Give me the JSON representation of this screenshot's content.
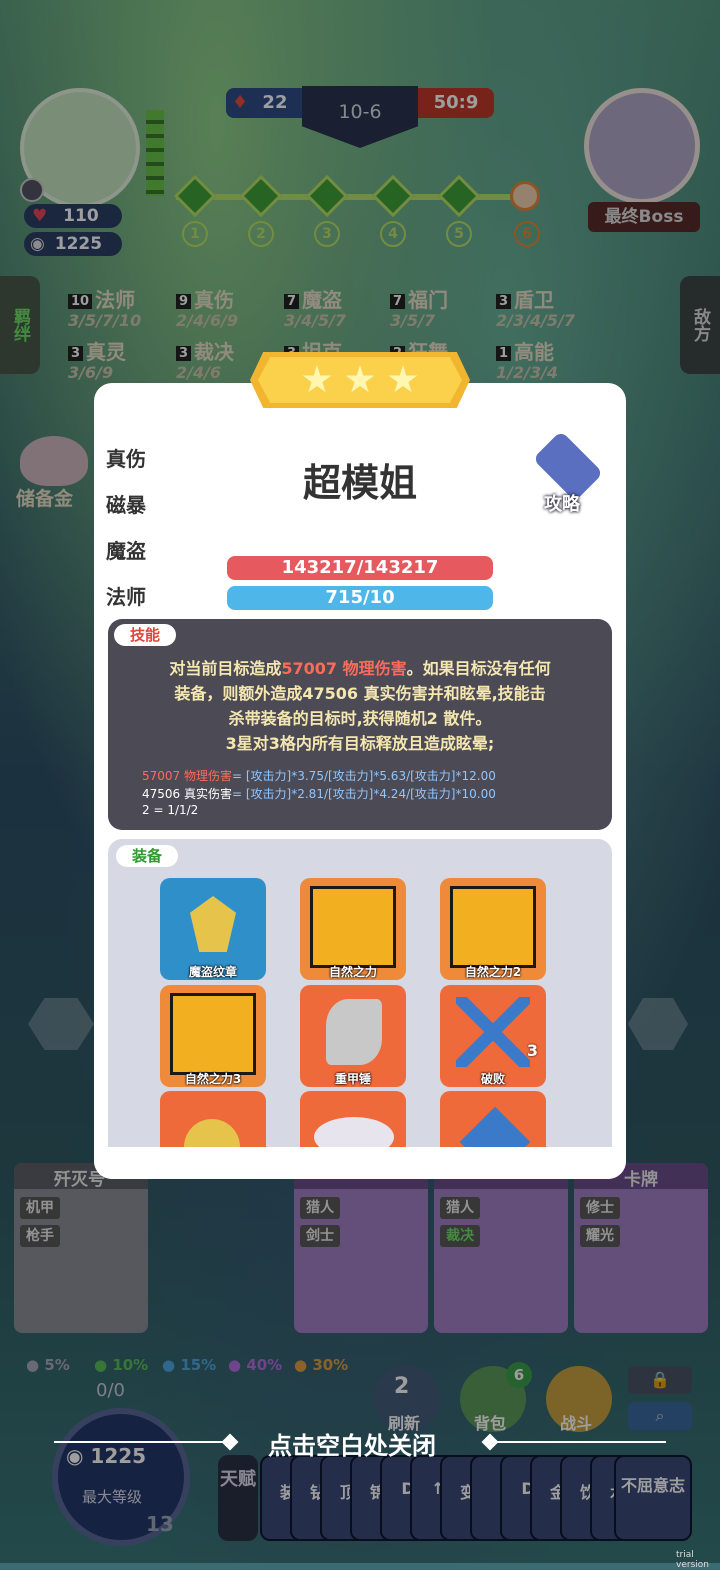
{
  "round": {
    "left_count": "22",
    "stage": "10-6",
    "score": "50:9"
  },
  "player": {
    "hp": "110",
    "gold": "1225"
  },
  "boss": {
    "label": "最终Boss"
  },
  "stage_nodes": [
    "1",
    "2",
    "3",
    "4",
    "5",
    "6"
  ],
  "side_tabs": {
    "left": "羁绊",
    "right": "敌方"
  },
  "traits": [
    {
      "count": "10",
      "name": "法师",
      "tiers": "3/5/7/10"
    },
    {
      "count": "9",
      "name": "真伤",
      "tiers": "2/4/6/9"
    },
    {
      "count": "7",
      "name": "魔盗",
      "tiers": "3/4/5/7"
    },
    {
      "count": "7",
      "name": "福门",
      "tiers": "3/5/7"
    },
    {
      "count": "3",
      "name": "盾卫",
      "tiers": "2/3/4/5/7"
    },
    {
      "count": "3",
      "name": "真灵",
      "tiers": "3/6/9"
    },
    {
      "count": "3",
      "name": "裁决",
      "tiers": "2/4/6"
    },
    {
      "count": "3",
      "name": "坦克",
      "tiers": ""
    },
    {
      "count": "2",
      "name": "狂舞",
      "tiers": ""
    },
    {
      "count": "1",
      "name": "高能",
      "tiers": "1/2/3/4"
    }
  ],
  "piggy": {
    "label": "储备金"
  },
  "modal": {
    "name": "超模姐",
    "guide_label": "攻略",
    "tabs": [
      "真伤",
      "磁暴",
      "魔盗",
      "法师"
    ],
    "hp": "143217/143217",
    "mana": "715/10",
    "skill_tag": "技能",
    "skill_lines": [
      {
        "pre": "对当前目标造成",
        "hl": "57007 物理伤害",
        "post": "。如果目标没有任何"
      },
      {
        "pre": "装备，则额外造成47506 真实伤害并和眩晕,技能击",
        "hl": "",
        "post": ""
      },
      {
        "pre": "杀带装备的目标时,获得随机2 散件。",
        "hl": "",
        "post": ""
      },
      {
        "pre": "3星对3格内所有目标释放且造成眩晕;",
        "hl": "",
        "post": ""
      }
    ],
    "formulas": [
      {
        "head": "57007 物理伤害",
        "body": "= [攻击力]*3.75/[攻击力]*5.63/[攻击力]*12.00",
        "kind": "red"
      },
      {
        "head": "47506 真实伤害",
        "body": "= [攻击力]*2.81/[攻击力]*4.24/[攻击力]*10.00",
        "kind": "blue"
      },
      {
        "head": "2",
        "body": " = 1/1/2",
        "kind": "plain"
      }
    ],
    "equip_tag": "装备",
    "items": [
      "魔盗纹章",
      "自然之力",
      "自然之力2",
      "自然之力3",
      "重甲锤",
      "破败",
      "",
      "",
      ""
    ],
    "item_badge": "3"
  },
  "bench": [
    {
      "title": "歼灭号",
      "chips": [
        "机甲",
        "枪手"
      ]
    },
    {
      "title": "",
      "chips": [
        "猎人",
        "剑士"
      ]
    },
    {
      "title": "",
      "chips": [
        "猎人",
        "裁决"
      ]
    },
    {
      "title": "卡牌",
      "chips": [
        "修士",
        "耀光"
      ]
    }
  ],
  "odds": [
    "5%",
    "10%",
    "15%",
    "40%",
    "30%"
  ],
  "xp": "0/0",
  "level": {
    "gold": "1225",
    "label": "最大等级",
    "num": "13"
  },
  "actions": {
    "refresh": "刷新",
    "refresh_cost": "2",
    "bag": "背包",
    "bag_badge": "6",
    "fight": "战斗"
  },
  "close_hint": "点击空白处关闭",
  "talent_label": "天赋",
  "talents": [
    "装",
    "钻",
    "顶",
    "锦",
    "D",
    "↑",
    "变",
    "",
    "D",
    "金",
    "饮",
    "水",
    "不屈意志"
  ],
  "watermark": "trial version",
  "colors": {
    "hp_bar": "#e65a5f",
    "mana_bar": "#4fb6ea",
    "star_gold": "#f7c33b",
    "item_blue": "#2f8fc8",
    "item_orange": "#ef6a3a"
  }
}
